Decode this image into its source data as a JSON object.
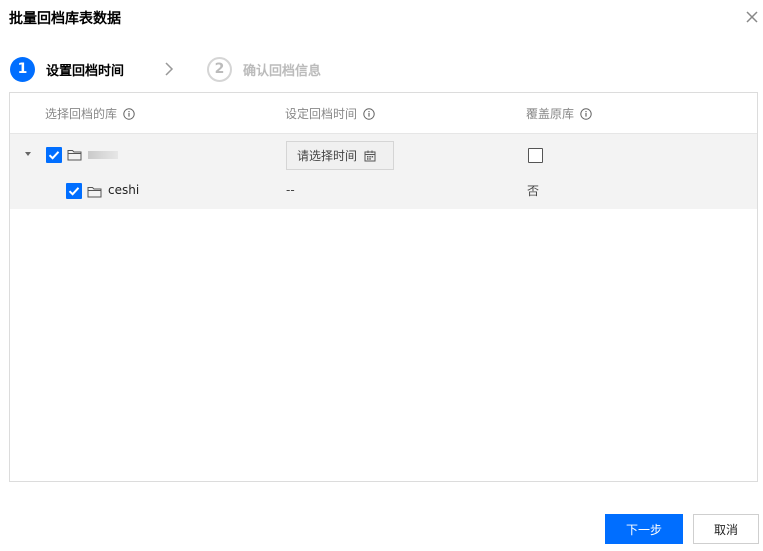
{
  "dialog": {
    "title": "批量回档库表数据"
  },
  "steps": [
    {
      "number": "1",
      "label": "设置回档时间",
      "state": "active"
    },
    {
      "number": "2",
      "label": "确认回档信息",
      "state": "inactive"
    }
  ],
  "table": {
    "headers": [
      "选择回档的库",
      "设定回档时间",
      "覆盖原库"
    ],
    "rows": [
      {
        "checked": true,
        "expanded": true,
        "name": "",
        "time_placeholder": "请选择时间",
        "cover_checked": false
      },
      {
        "checked": true,
        "name": "ceshi",
        "time": "--",
        "cover": "否"
      }
    ]
  },
  "footer": {
    "next_label": "下一步",
    "cancel_label": "取消"
  },
  "colors": {
    "accent": "#006eff",
    "row_bg": "#f3f3f3"
  },
  "icons": [
    "close-icon",
    "chevron-right-icon",
    "info-icon",
    "caret-down-icon",
    "folder-icon",
    "calendar-icon",
    "check-icon"
  ]
}
